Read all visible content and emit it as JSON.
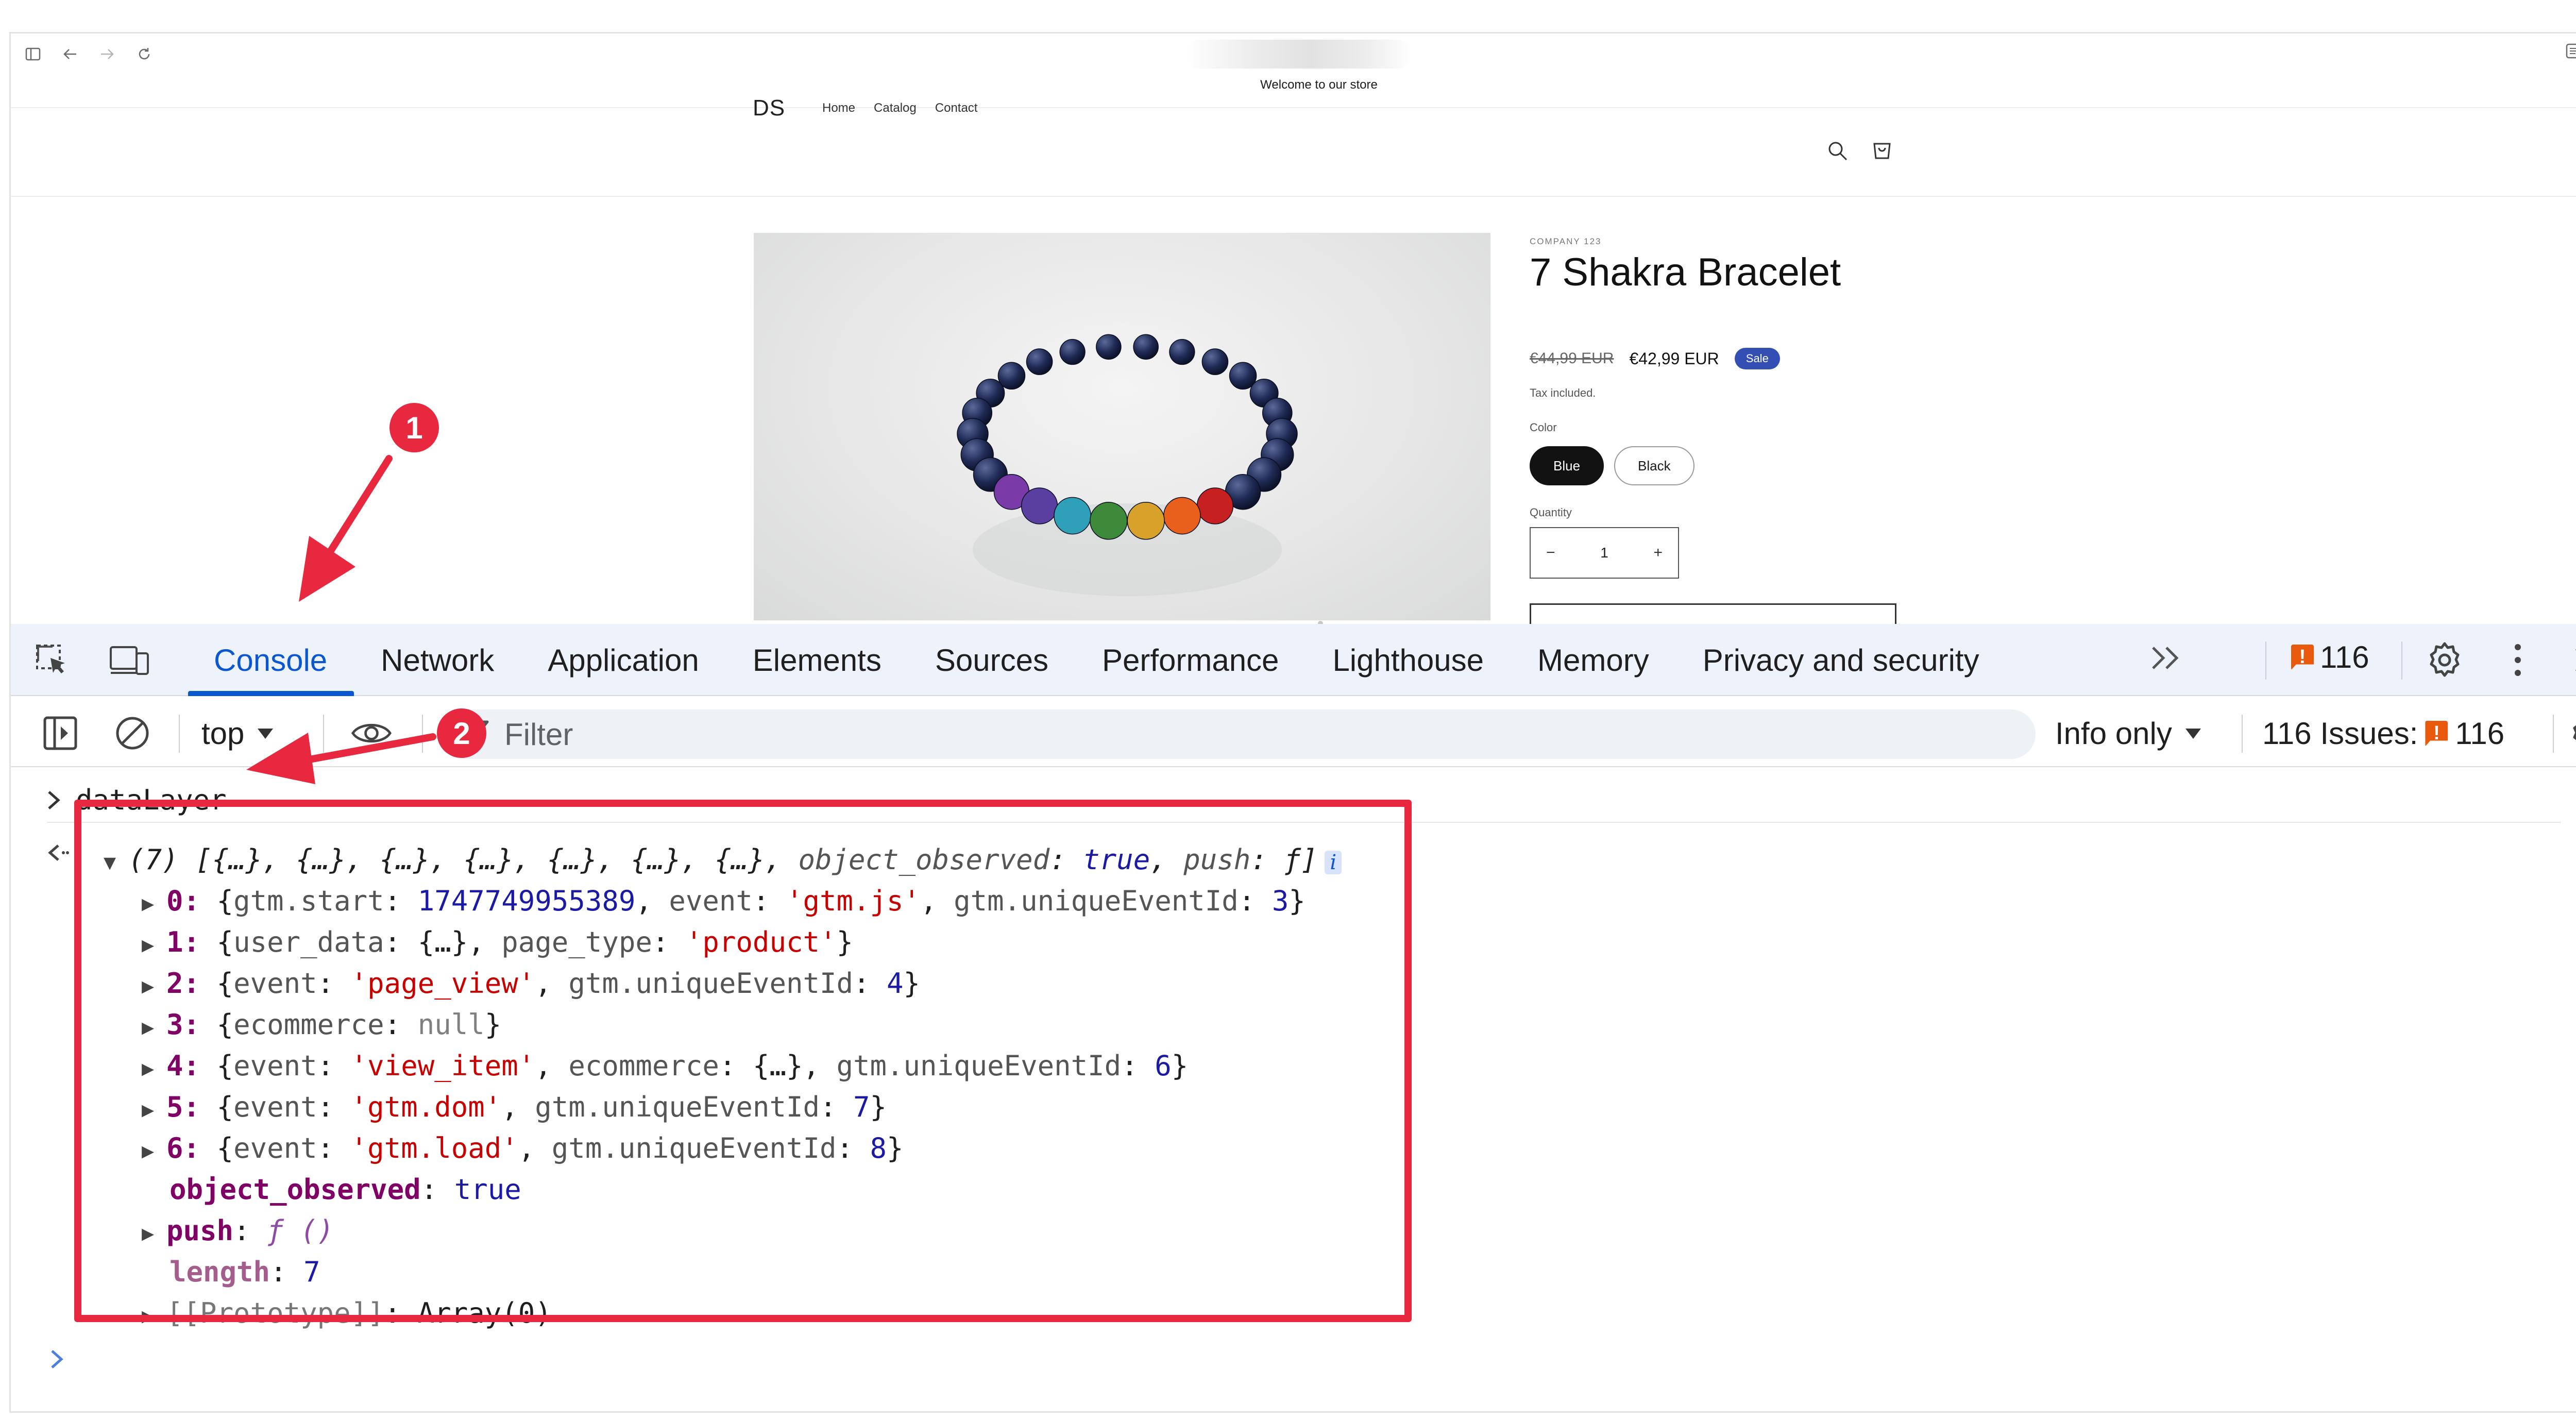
{
  "browser": {
    "icons": [
      "sidebar-icon",
      "back-icon",
      "forward-icon",
      "reload-icon"
    ],
    "right_icons": [
      "reader-icon",
      "split-view-icon"
    ]
  },
  "store": {
    "announcement": "Welcome to our store",
    "logo": "DS",
    "nav": [
      "Home",
      "Catalog",
      "Contact"
    ],
    "product": {
      "vendor": "COMPANY 123",
      "title": "7 Shakra Bracelet",
      "old_price": "€44,99 EUR",
      "price": "€42,99 EUR",
      "badge": "Sale",
      "tax_note": "Tax included.",
      "color_label": "Color",
      "colors": [
        {
          "label": "Blue",
          "selected": true
        },
        {
          "label": "Black",
          "selected": false
        }
      ],
      "quantity_label": "Quantity",
      "quantity": "1",
      "qty_minus": "−",
      "qty_plus": "+"
    }
  },
  "devtools": {
    "tabs": [
      "Console",
      "Network",
      "Application",
      "Elements",
      "Sources",
      "Performance",
      "Lighthouse",
      "Memory",
      "Privacy and security"
    ],
    "active_tab": "Console",
    "more_tabs": "»",
    "issues_badge_count": "116",
    "issue_flag_glyph": "!",
    "context": "top",
    "filter_placeholder": "Filter",
    "log_level": "Info only",
    "issues_label": "116 Issues:",
    "issues_count": "116",
    "colors": {
      "accent": "#0b57d0",
      "issue": "#e8590c",
      "annotation": "#e8283e"
    }
  },
  "console": {
    "command": "dataLayer",
    "summary": {
      "count": "(7)",
      "items": "[{…}, {…}, {…}, {…}, {…}, {…}, {…}, ",
      "prop_key": "object_observed",
      "prop_val": "true",
      "push_key": "push",
      "push_val": "ƒ",
      "close": "]",
      "info": "i"
    },
    "entries": [
      {
        "idx": "0:",
        "parts": [
          [
            "p",
            "{"
          ],
          [
            "k",
            "gtm.start"
          ],
          [
            "p",
            ": "
          ],
          [
            "num",
            "1747749955389"
          ],
          [
            "p",
            ", "
          ],
          [
            "k",
            "event"
          ],
          [
            "p",
            ": "
          ],
          [
            "str",
            "'gtm.js'"
          ],
          [
            "p",
            ", "
          ],
          [
            "k",
            "gtm.uniqueEventId"
          ],
          [
            "p",
            ": "
          ],
          [
            "num",
            "3"
          ],
          [
            "p",
            "}"
          ]
        ]
      },
      {
        "idx": "1:",
        "parts": [
          [
            "p",
            "{"
          ],
          [
            "k",
            "user_data"
          ],
          [
            "p",
            ": {…}, "
          ],
          [
            "k",
            "page_type"
          ],
          [
            "p",
            ": "
          ],
          [
            "str",
            "'product'"
          ],
          [
            "p",
            "}"
          ]
        ]
      },
      {
        "idx": "2:",
        "parts": [
          [
            "p",
            "{"
          ],
          [
            "k",
            "event"
          ],
          [
            "p",
            ": "
          ],
          [
            "str",
            "'page_view'"
          ],
          [
            "p",
            ", "
          ],
          [
            "k",
            "gtm.uniqueEventId"
          ],
          [
            "p",
            ": "
          ],
          [
            "num",
            "4"
          ],
          [
            "p",
            "}"
          ]
        ]
      },
      {
        "idx": "3:",
        "parts": [
          [
            "p",
            "{"
          ],
          [
            "k",
            "ecommerce"
          ],
          [
            "p",
            ": "
          ],
          [
            "nul",
            "null"
          ],
          [
            "p",
            "}"
          ]
        ]
      },
      {
        "idx": "4:",
        "parts": [
          [
            "p",
            "{"
          ],
          [
            "k",
            "event"
          ],
          [
            "p",
            ": "
          ],
          [
            "str",
            "'view_item'"
          ],
          [
            "p",
            ", "
          ],
          [
            "k",
            "ecommerce"
          ],
          [
            "p",
            ": {…}, "
          ],
          [
            "k",
            "gtm.uniqueEventId"
          ],
          [
            "p",
            ": "
          ],
          [
            "num",
            "6"
          ],
          [
            "p",
            "}"
          ]
        ]
      },
      {
        "idx": "5:",
        "parts": [
          [
            "p",
            "{"
          ],
          [
            "k",
            "event"
          ],
          [
            "p",
            ": "
          ],
          [
            "str",
            "'gtm.dom'"
          ],
          [
            "p",
            ", "
          ],
          [
            "k",
            "gtm.uniqueEventId"
          ],
          [
            "p",
            ": "
          ],
          [
            "num",
            "7"
          ],
          [
            "p",
            "}"
          ]
        ]
      },
      {
        "idx": "6:",
        "parts": [
          [
            "p",
            "{"
          ],
          [
            "k",
            "event"
          ],
          [
            "p",
            ": "
          ],
          [
            "str",
            "'gtm.load'"
          ],
          [
            "p",
            ", "
          ],
          [
            "k",
            "gtm.uniqueEventId"
          ],
          [
            "p",
            ": "
          ],
          [
            "num",
            "8"
          ],
          [
            "p",
            "}"
          ]
        ]
      }
    ],
    "object_observed_key": "object_observed",
    "object_observed_val": "true",
    "push_key": "push",
    "push_val": "ƒ ()",
    "length_key": "length",
    "length_val": "7",
    "proto_key": "[[Prototype]]",
    "proto_val": "Array(0)"
  },
  "annotations": {
    "step1": "1",
    "step2": "2"
  }
}
